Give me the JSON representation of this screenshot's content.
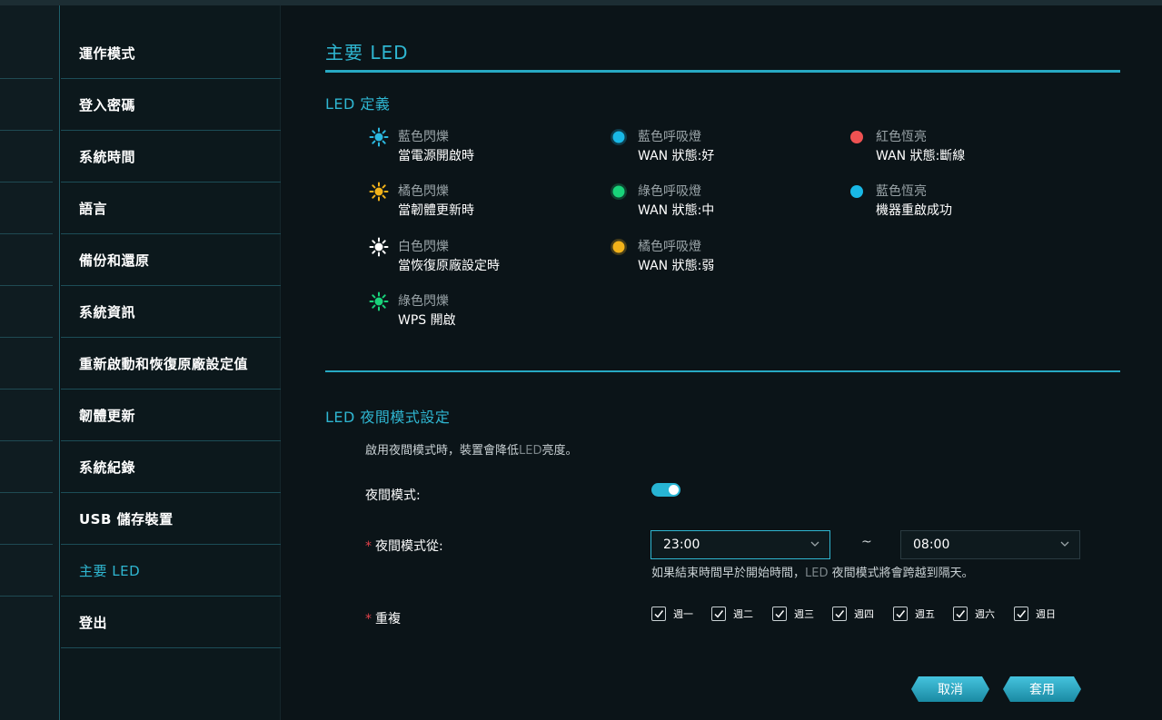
{
  "sidebar": {
    "items": [
      {
        "label": "運作模式"
      },
      {
        "label": "登入密碼"
      },
      {
        "label": "系統時間"
      },
      {
        "label": "語言"
      },
      {
        "label": "備份和還原"
      },
      {
        "label": "系統資訊"
      },
      {
        "label": "重新啟動和恢復原廠設定值"
      },
      {
        "label": "韌體更新"
      },
      {
        "label": "系統紀錄"
      },
      {
        "label": "USB 儲存裝置"
      },
      {
        "label": "主要 LED"
      },
      {
        "label": "登出"
      }
    ],
    "active_index": 10
  },
  "page": {
    "title": "主要 LED"
  },
  "led_definition": {
    "title": "LED 定義",
    "entries": [
      {
        "name": "藍色閃爍",
        "desc": "當電源開啟時",
        "icon": "blinking-sun-icon",
        "color": "#2bb8e0"
      },
      {
        "name": "橘色閃爍",
        "desc": "當韌體更新時",
        "icon": "blinking-sun-icon",
        "color": "#f2b21a"
      },
      {
        "name": "白色閃爍",
        "desc": "當恢復原廠設定時",
        "icon": "blinking-sun-icon",
        "color": "#ffffff"
      },
      {
        "name": "綠色閃爍",
        "desc": "WPS 開啟",
        "icon": "blinking-sun-icon",
        "color": "#19d37a"
      },
      {
        "name": "藍色呼吸燈",
        "desc": "WAN 狀態:好",
        "icon": "breathing-dot-icon",
        "color": "#19b8e6"
      },
      {
        "name": "綠色呼吸燈",
        "desc": "WAN 狀態:中",
        "icon": "breathing-dot-icon",
        "color": "#19d37a"
      },
      {
        "name": "橘色呼吸燈",
        "desc": "WAN 狀態:弱",
        "icon": "breathing-dot-icon",
        "color": "#f2b21a"
      },
      {
        "name": "紅色恆亮",
        "desc": "WAN 狀態:斷線",
        "icon": "solid-dot-icon",
        "color": "#ee5252"
      },
      {
        "name": "藍色恆亮",
        "desc": "機器重啟成功",
        "icon": "solid-dot-icon",
        "color": "#19b8e6"
      }
    ]
  },
  "night_mode": {
    "title": "LED 夜間模式設定",
    "hint_prefix": "啟用夜間模式時，裝置會降低",
    "hint_led": "LED",
    "hint_suffix": "亮度。",
    "toggle_label": "夜間模式:",
    "toggle_on": true,
    "from_label": "夜間模式從:",
    "from_value": "23:00",
    "tilde": "~",
    "to_value": "08:00",
    "note_prefix": "如果結束時間早於開始時間，",
    "note_led": "LED",
    "note_suffix": " 夜間模式將會跨越到隔天。",
    "repeat_label": "重複",
    "days": [
      {
        "label": "週一",
        "checked": true
      },
      {
        "label": "週二",
        "checked": true
      },
      {
        "label": "週三",
        "checked": true
      },
      {
        "label": "週四",
        "checked": true
      },
      {
        "label": "週五",
        "checked": true
      },
      {
        "label": "週六",
        "checked": true
      },
      {
        "label": "週日",
        "checked": true
      }
    ]
  },
  "buttons": {
    "cancel": "取消",
    "apply": "套用"
  },
  "colors": {
    "accent": "#2fb6d1",
    "required": "#e0414b"
  }
}
